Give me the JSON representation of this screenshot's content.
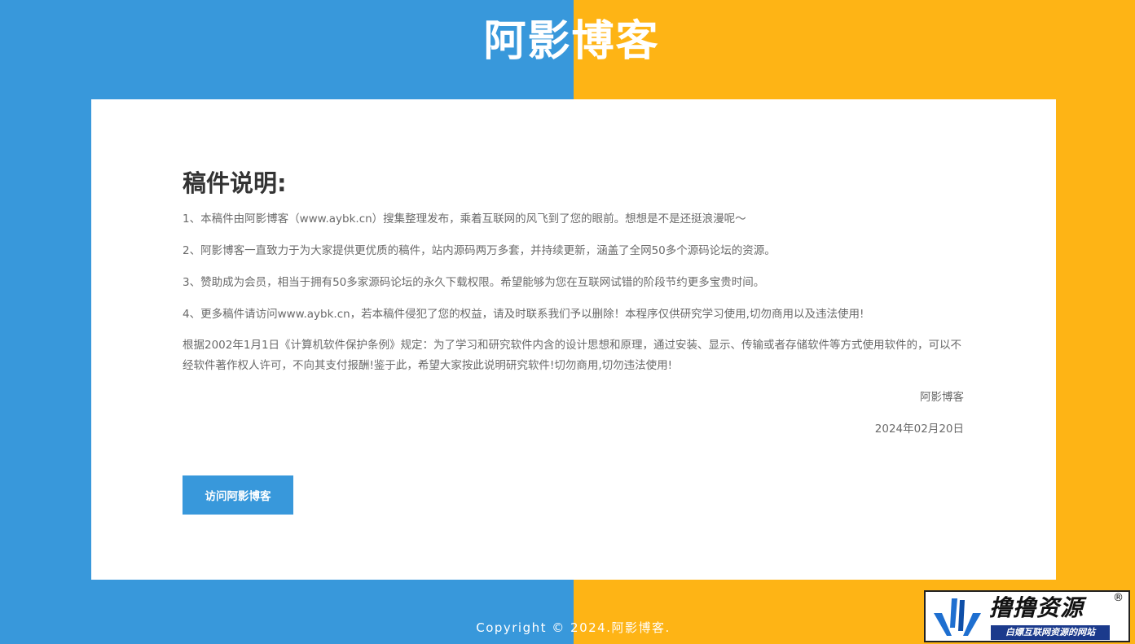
{
  "site": {
    "title": "阿影博客"
  },
  "notice": {
    "heading": "稿件说明:",
    "items": [
      "1、本稿件由阿影博客（www.aybk.cn）搜集整理发布，乘着互联网的风飞到了您的眼前。想想是不是还挺浪漫呢～",
      "2、阿影博客一直致力于为大家提供更优质的稿件，站内源码两万多套，并持续更新，涵盖了全网50多个源码论坛的资源。",
      "3、赞助成为会员，相当于拥有50多家源码论坛的永久下载权限。希望能够为您在互联网试错的阶段节约更多宝贵时间。",
      "4、更多稿件请访问www.aybk.cn，若本稿件侵犯了您的权益，请及时联系我们予以删除！本程序仅供研究学习使用,切勿商用以及违法使用!"
    ],
    "law": "根据2002年1月1日《计算机软件保护条例》规定：为了学习和研究软件内含的设计思想和原理，通过安装、显示、传输或者存储软件等方式使用软件的，可以不经软件著作权人许可，不向其支付报酬!鉴于此，希望大家按此说明研究软件!切勿商用,切勿违法使用!",
    "signature": "阿影博客",
    "date": "2024年02月20日",
    "button_label": "访问阿影博客"
  },
  "footer": {
    "copyright": "Copyright © 2024.阿影博客."
  },
  "watermark": {
    "title": "撸撸资源",
    "registered_mark": "®",
    "subtitle": "白嫖互联网资源的网站",
    "logo_icon": "blue-lightning-logo-icon"
  },
  "colors": {
    "left_background": "#3898db",
    "right_background": "#feb415",
    "card": "#ffffff",
    "button": "#3898db",
    "heading_text": "#333333",
    "body_text": "#6a6a6a"
  }
}
